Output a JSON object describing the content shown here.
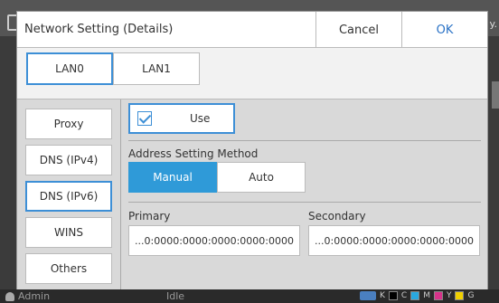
{
  "background": {
    "right_text": "y."
  },
  "dialog": {
    "title": "Network Setting (Details)",
    "cancel_label": "Cancel",
    "ok_label": "OK",
    "tabs": [
      {
        "label": "LAN0",
        "active": true
      },
      {
        "label": "LAN1",
        "active": false
      }
    ],
    "sidebar": [
      {
        "label": "Proxy",
        "active": false
      },
      {
        "label": "DNS (IPv4)",
        "active": false
      },
      {
        "label": "DNS (IPv6)",
        "active": true
      },
      {
        "label": "WINS",
        "active": false
      },
      {
        "label": "Others",
        "active": false
      }
    ],
    "use": {
      "label": "Use",
      "checked": true
    },
    "address_method": {
      "label": "Address Setting Method",
      "options": [
        "Manual",
        "Auto"
      ],
      "selected": "Manual"
    },
    "primary": {
      "label": "Primary",
      "value": "...0:0000:0000:0000:0000:0000"
    },
    "secondary": {
      "label": "Secondary",
      "value": "...0:0000:0000:0000:0000:0000"
    }
  },
  "statusbar": {
    "user": "Admin",
    "state": "Idle",
    "inks": [
      {
        "label": "K",
        "color": "#000000"
      },
      {
        "label": "C",
        "color": "#29a8e0"
      },
      {
        "label": "M",
        "color": "#d6338a"
      },
      {
        "label": "Y",
        "color": "#f0d000"
      },
      {
        "label": "G",
        "color": "#f2f2f2"
      }
    ]
  },
  "colors": {
    "accent": "#3d8fd6",
    "selected_segment": "#2f9ad8"
  }
}
